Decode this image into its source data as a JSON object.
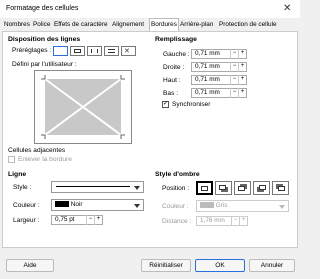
{
  "window": {
    "title": "Formatage des cellules"
  },
  "tabs": [
    "Nombres",
    "Police",
    "Effets de caractère",
    "Alignement",
    "Bordures",
    "Arrière-plan",
    "Protection de cellule"
  ],
  "borders": {
    "line_arrangement": "Disposition des lignes",
    "presets_label": "Préréglages :",
    "user_defined_label": "Défini par l'utilisateur :",
    "adjacent_cells": "Cellules adjacentes",
    "remove_border": "Enlever la bordure"
  },
  "padding": {
    "title": "Remplissage",
    "left_label": "Gauche :",
    "left": "0,71 mm",
    "right_label": "Droite :",
    "right": "0,71 mm",
    "top_label": "Haut :",
    "top": "0,71 mm",
    "bottom_label": "Bas :",
    "bottom": "0,71 mm",
    "sync": "Synchroniser"
  },
  "line": {
    "title": "Ligne",
    "style_label": "Style :",
    "color_label": "Couleur :",
    "color": "Noir",
    "width_label": "Largeur :",
    "width": "0,75 pt"
  },
  "shadow": {
    "title": "Style d'ombre",
    "position_label": "Position :",
    "color_label": "Couleur :",
    "color": "Gris",
    "distance_label": "Distance :",
    "distance": "1,76 mm"
  },
  "buttons": {
    "help": "Aide",
    "reset": "Réinitialiser",
    "ok": "OK",
    "cancel": "Annuler"
  },
  "colors": {
    "accent": "#2a6fdb",
    "preview_fill": "#c8c8c8"
  }
}
